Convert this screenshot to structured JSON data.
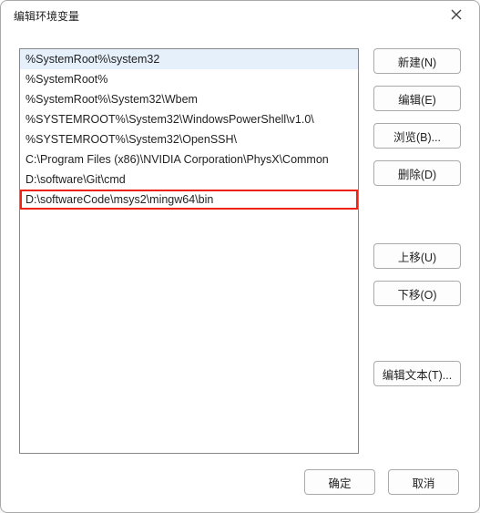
{
  "dialog": {
    "title": "编辑环境变量"
  },
  "list": {
    "items": [
      {
        "text": "%SystemRoot%\\system32",
        "selected": true,
        "highlighted": false
      },
      {
        "text": "%SystemRoot%",
        "selected": false,
        "highlighted": false
      },
      {
        "text": "%SystemRoot%\\System32\\Wbem",
        "selected": false,
        "highlighted": false
      },
      {
        "text": "%SYSTEMROOT%\\System32\\WindowsPowerShell\\v1.0\\",
        "selected": false,
        "highlighted": false
      },
      {
        "text": "%SYSTEMROOT%\\System32\\OpenSSH\\",
        "selected": false,
        "highlighted": false
      },
      {
        "text": "C:\\Program Files (x86)\\NVIDIA Corporation\\PhysX\\Common",
        "selected": false,
        "highlighted": false
      },
      {
        "text": "D:\\software\\Git\\cmd",
        "selected": false,
        "highlighted": false
      },
      {
        "text": "D:\\softwareCode\\msys2\\mingw64\\bin",
        "selected": false,
        "highlighted": true
      }
    ]
  },
  "buttons": {
    "new": "新建(N)",
    "edit": "编辑(E)",
    "browse": "浏览(B)...",
    "delete": "删除(D)",
    "move_up": "上移(U)",
    "move_down": "下移(O)",
    "edit_text": "编辑文本(T)...",
    "ok": "确定",
    "cancel": "取消"
  }
}
